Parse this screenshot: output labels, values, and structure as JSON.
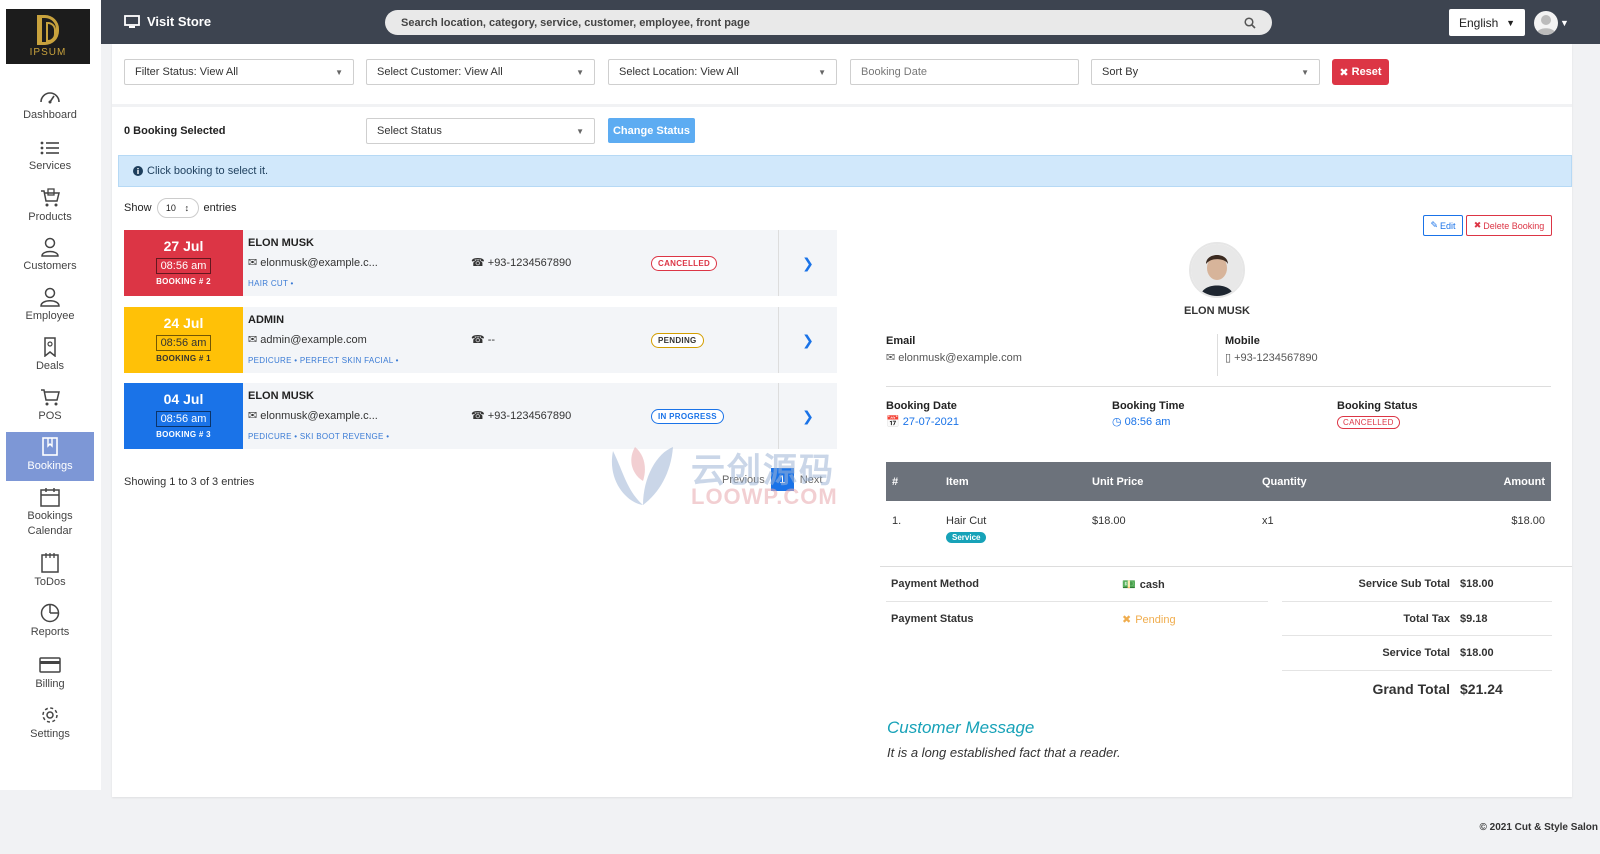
{
  "colors": {
    "topbar": "#3d4450",
    "sidebar_active": "#7d97d6",
    "accent_blue": "#1a73e8",
    "danger": "#dc3545",
    "warning": "#ffc107",
    "teal": "#17a2b8"
  },
  "logo": {
    "text": "IPSUM"
  },
  "sidebar": {
    "items": [
      {
        "label": "Dashboard",
        "icon": "gauge-icon"
      },
      {
        "label": "Services",
        "icon": "list-icon"
      },
      {
        "label": "Products",
        "icon": "cart-icon"
      },
      {
        "label": "Customers",
        "icon": "user-icon"
      },
      {
        "label": "Employee",
        "icon": "user-tie-icon"
      },
      {
        "label": "Deals",
        "icon": "ribbon-icon"
      },
      {
        "label": "POS",
        "icon": "shopping-cart-icon"
      },
      {
        "label": "Bookings",
        "icon": "bookmark-icon",
        "active": true
      },
      {
        "label": "Bookings",
        "label2": "Calendar",
        "icon": "calendar-icon"
      },
      {
        "label": "ToDos",
        "icon": "notepad-icon"
      },
      {
        "label": "Reports",
        "icon": "pie-chart-icon"
      },
      {
        "label": "Billing",
        "icon": "credit-card-icon"
      },
      {
        "label": "Settings",
        "icon": "gear-icon"
      }
    ]
  },
  "topbar": {
    "visit_store": "Visit Store",
    "search_placeholder": "Search location, category, service, customer, employee, front page",
    "language": "English"
  },
  "filters": {
    "status": "Filter Status: View All",
    "customer": "Select Customer: View All",
    "location": "Select Location: View All",
    "booking_date_placeholder": "Booking Date",
    "sort_by": "Sort By",
    "reset": "Reset"
  },
  "bulk": {
    "selected": "0 Booking Selected",
    "select_status": "Select Status",
    "change_status": "Change Status"
  },
  "info_alert": "Click booking to select it.",
  "table": {
    "show": "Show",
    "entries_value": "10",
    "entries": "entries",
    "showing": "Showing 1 to 3 of 3 entries",
    "previous": "Previous",
    "page": "1",
    "next": "Next"
  },
  "bookings": [
    {
      "date": "27 Jul",
      "time": "08:56 am",
      "number": "BOOKING # 2",
      "name": "ELON MUSK",
      "email": "elonmusk@example.c...",
      "phone": "+93-1234567890",
      "services": "HAIR CUT •",
      "status": "CANCELLED",
      "color": "#dc3545",
      "status_color": "#dc3545"
    },
    {
      "date": "24 Jul",
      "time": "08:56 am",
      "number": "BOOKING # 1",
      "name": "ADMIN",
      "email": "admin@example.com",
      "phone": "--",
      "services": "PEDICURE • PERFECT SKIN FACIAL •",
      "status": "PENDING",
      "color": "#ffc107",
      "status_color": "#d39e00"
    },
    {
      "date": "04 Jul",
      "time": "08:56 am",
      "number": "BOOKING # 3",
      "name": "ELON MUSK",
      "email": "elonmusk@example.c...",
      "phone": "+93-1234567890",
      "services": "PEDICURE • SKI BOOT REVENGE •",
      "status": "IN PROGRESS",
      "color": "#1a73e8",
      "status_color": "#1a73e8"
    }
  ],
  "detail": {
    "edit": "Edit",
    "delete": "Delete Booking",
    "name": "ELON MUSK",
    "email_label": "Email",
    "email": "elonmusk@example.com",
    "mobile_label": "Mobile",
    "mobile": "+93-1234567890",
    "date_label": "Booking Date",
    "date": "27-07-2021",
    "time_label": "Booking Time",
    "time": "08:56 am",
    "status_label": "Booking Status",
    "status": "CANCELLED",
    "items_head": {
      "num": "#",
      "item": "Item",
      "unit_price": "Unit Price",
      "quantity": "Quantity",
      "amount": "Amount"
    },
    "items": [
      {
        "num": "1.",
        "item": "Hair Cut",
        "tag": "Service",
        "unit_price": "$18.00",
        "quantity": "x1",
        "amount": "$18.00"
      }
    ],
    "payment_method_label": "Payment Method",
    "payment_method": "cash",
    "payment_status_label": "Payment Status",
    "payment_status": "Pending",
    "sub_total_label": "Service Sub Total",
    "sub_total": "$18.00",
    "tax_label": "Total Tax",
    "tax": "$9.18",
    "service_total_label": "Service Total",
    "service_total": "$18.00",
    "grand_total_label": "Grand Total",
    "grand_total": "$21.24",
    "message_title": "Customer Message",
    "message": "It is a long established fact that a reader."
  },
  "watermark": {
    "cn": "云创源码",
    "en": "LOOWP.COM"
  },
  "footer": "© 2021 Cut & Style Salon"
}
